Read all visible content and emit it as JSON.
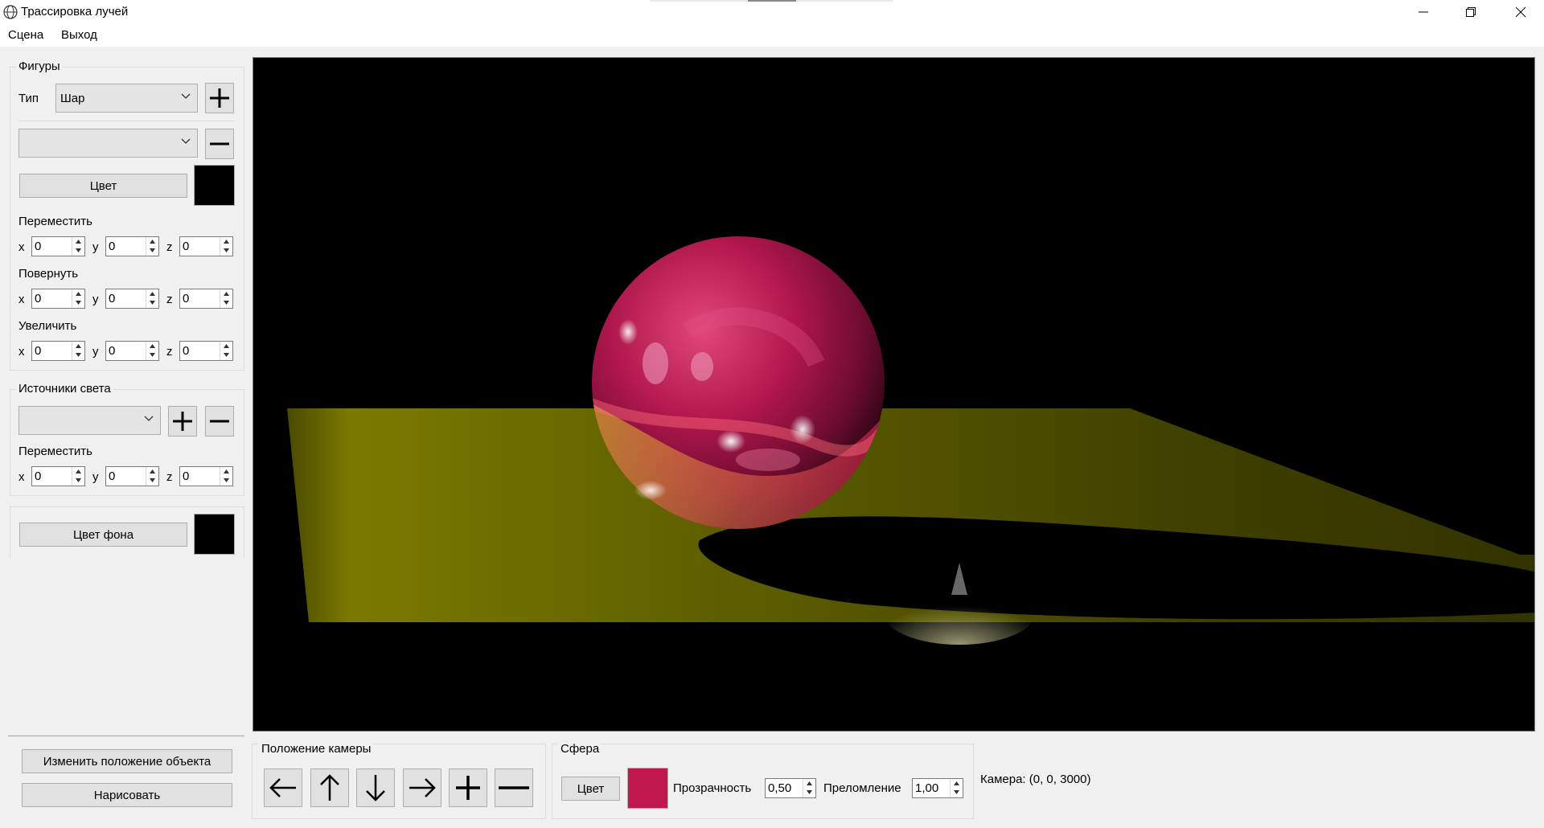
{
  "window": {
    "title": "Трассировка лучей",
    "buttons": [
      "minimize-icon",
      "restore-icon",
      "close-icon"
    ]
  },
  "menu": {
    "items": [
      "Сцена",
      "Выход"
    ]
  },
  "figures": {
    "group_title": "Фигуры",
    "type_label": "Тип",
    "type_value": "Шар",
    "object_value": "",
    "color_button": "Цвет",
    "color_swatch": "#000000",
    "move_label": "Переместить",
    "rotate_label": "Повернуть",
    "scale_label": "Увеличить",
    "axes": [
      "x",
      "y",
      "z"
    ],
    "move": [
      "0",
      "0",
      "0"
    ],
    "rotate": [
      "0",
      "0",
      "0"
    ],
    "scale": [
      "0",
      "0",
      "0"
    ]
  },
  "lights": {
    "group_title": "Источники света",
    "light_value": "",
    "move_label": "Переместить",
    "move": [
      "0",
      "0",
      "0"
    ]
  },
  "background": {
    "button": "Цвет фона",
    "swatch": "#000000"
  },
  "actions": {
    "change_position": "Изменить положение объекта",
    "draw": "Нарисовать"
  },
  "camera": {
    "group_title": "Положение камеры",
    "buttons": [
      "arrow-left-icon",
      "arrow-up-icon",
      "arrow-down-icon",
      "arrow-right-icon",
      "plus-icon",
      "minus-icon"
    ],
    "status": "Камера: (0, 0, 3000)"
  },
  "sphere": {
    "group_title": "Сфера",
    "color_button": "Цвет",
    "swatch": "#c0184f",
    "transparency_label": "Прозрачность",
    "transparency_value": "0,50",
    "refraction_label": "Преломление",
    "refraction_value": "1,00"
  },
  "colors": {
    "sphere": "#c0184f",
    "plane": "#7a7a00",
    "viewport_bg": "#000000"
  }
}
